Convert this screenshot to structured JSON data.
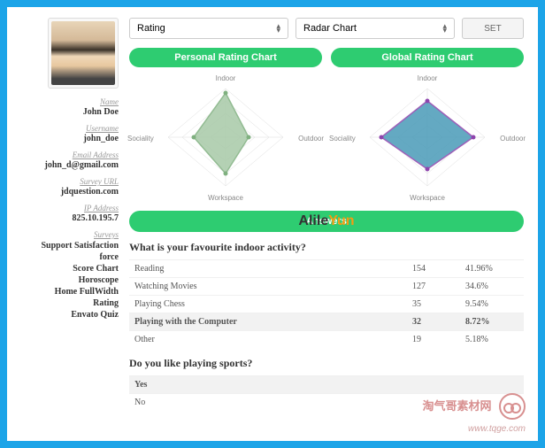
{
  "sidebar": {
    "name_label": "Name",
    "name": "John Doe",
    "username_label": "Username",
    "username": "john_doe",
    "email_label": "Email Address",
    "email": "john_d@gmail.com",
    "survey_url_label": "Survey URL",
    "survey_url": "jdquestion.com",
    "ip_label": "IP Address",
    "ip": "825.10.195.7",
    "surveys_label": "Surveys",
    "surveys": [
      "Support Satisfaction",
      "force",
      "Score Chart",
      "Horoscope",
      "Home FullWidth",
      "Rating",
      "Envato Quiz"
    ]
  },
  "controls": {
    "select1": "Rating",
    "select2": "Radar Chart",
    "set_btn": "SET"
  },
  "charts": {
    "personal_title": "Personal Rating Chart",
    "global_title": "Global Rating Chart",
    "axes": [
      "Indoor",
      "Outdoor",
      "Workspace",
      "Sociality"
    ]
  },
  "answers_header": "Answers",
  "q1": {
    "text": "What is your favourite indoor activity?",
    "rows": [
      {
        "label": "Reading",
        "count": "154",
        "pct": "41.96%"
      },
      {
        "label": "Watching Movies",
        "count": "127",
        "pct": "34.6%"
      },
      {
        "label": "Playing Chess",
        "count": "35",
        "pct": "9.54%"
      },
      {
        "label": "Playing with the Computer",
        "count": "32",
        "pct": "8.72%",
        "hl": true
      },
      {
        "label": "Other",
        "count": "19",
        "pct": "5.18%"
      }
    ]
  },
  "q2": {
    "text": "Do you like playing sports?",
    "rows": [
      {
        "label": "Yes",
        "count": "",
        "pct": "",
        "hl": true
      },
      {
        "label": "No",
        "count": "",
        "pct": ""
      }
    ]
  },
  "watermark": {
    "part1": "Alile",
    "part2": "Yun"
  },
  "footer": {
    "line1": "淘气哥素材网",
    "line2": "www.tqge.com"
  },
  "chart_data": [
    {
      "type": "radar",
      "title": "Personal Rating Chart",
      "categories": [
        "Indoor",
        "Outdoor",
        "Workspace",
        "Sociality"
      ],
      "values": [
        90,
        40,
        75,
        55
      ],
      "fill": "#a8c9a8",
      "stroke": "#7fb07f"
    },
    {
      "type": "radar",
      "title": "Global Rating Chart",
      "categories": [
        "Indoor",
        "Outdoor",
        "Workspace",
        "Sociality"
      ],
      "values": [
        75,
        80,
        65,
        80
      ],
      "fill": "#4a9bb8",
      "stroke": "#8e44ad"
    }
  ]
}
